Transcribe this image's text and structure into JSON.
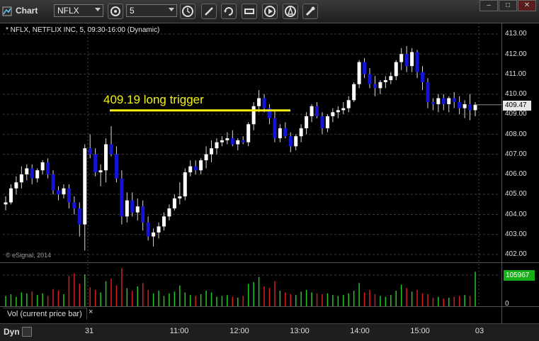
{
  "toolbar": {
    "title": "Chart",
    "symbol": "NFLX",
    "interval": "5",
    "icons": [
      "link-icon",
      "settings-icon",
      "clock-icon",
      "pencil-icon",
      "refresh-icon",
      "news-icon",
      "play-icon",
      "alert-icon",
      "tools-icon"
    ]
  },
  "window_controls": [
    "minimize",
    "maximize",
    "close"
  ],
  "chart": {
    "title": "* NFLX, NETFLIX INC, 5, 09:30-16:00 (Dynamic)",
    "watermark": "© eSignal, 2014",
    "annotation": "409.19 long trigger",
    "annotation_color": "#f4f010",
    "current_price": "409.47",
    "price_ticks": [
      "413.00",
      "412.00",
      "411.00",
      "410.00",
      "409.00",
      "408.00",
      "407.00",
      "406.00",
      "405.00",
      "404.00",
      "403.00",
      "402.00"
    ],
    "colors": {
      "up": "#ffffff",
      "down": "#1414d8",
      "vol_up": "#22c922",
      "vol_down": "#d81e1e"
    }
  },
  "volume": {
    "label": "Vol (current price bar)",
    "last_value": "105967",
    "zero_label": "0",
    "close_glyph": "×"
  },
  "bottom": {
    "mode": "Dyn",
    "time_labels": [
      "31",
      "11:00",
      "12:00",
      "13:00",
      "14:00",
      "15:00",
      "03"
    ]
  },
  "chart_data": {
    "type": "candlestick",
    "ylim": [
      401.8,
      413.5
    ],
    "long_trigger": 409.19,
    "candles": [
      [
        404.5,
        404.9,
        404.2,
        404.6
      ],
      [
        404.6,
        405.5,
        404.5,
        405.3
      ],
      [
        405.3,
        405.9,
        405.0,
        405.6
      ],
      [
        405.6,
        406.4,
        405.3,
        406.0
      ],
      [
        406.0,
        406.5,
        405.7,
        406.3
      ],
      [
        406.3,
        406.5,
        405.5,
        405.8
      ],
      [
        405.8,
        406.3,
        405.6,
        406.2
      ],
      [
        406.2,
        406.7,
        406.0,
        406.6
      ],
      [
        406.6,
        406.8,
        405.8,
        406.0
      ],
      [
        406.0,
        406.2,
        405.0,
        405.2
      ],
      [
        405.2,
        405.4,
        404.7,
        405.0
      ],
      [
        405.0,
        405.5,
        404.8,
        405.3
      ],
      [
        405.3,
        405.5,
        404.3,
        404.6
      ],
      [
        404.6,
        404.9,
        404.0,
        404.3
      ],
      [
        404.3,
        404.6,
        402.9,
        403.5
      ],
      [
        403.5,
        407.5,
        402.2,
        407.3
      ],
      [
        407.3,
        408.0,
        406.8,
        407.0
      ],
      [
        407.0,
        407.3,
        405.9,
        406.1
      ],
      [
        406.1,
        406.5,
        405.4,
        406.2
      ],
      [
        406.2,
        407.8,
        405.6,
        407.5
      ],
      [
        407.5,
        408.4,
        406.9,
        407.0
      ],
      [
        407.0,
        407.4,
        405.6,
        405.8
      ],
      [
        405.8,
        406.2,
        403.5,
        403.9
      ],
      [
        403.9,
        405.1,
        403.6,
        404.7
      ],
      [
        404.7,
        405.1,
        403.9,
        404.1
      ],
      [
        404.1,
        404.8,
        403.7,
        404.4
      ],
      [
        404.4,
        404.7,
        403.2,
        403.6
      ],
      [
        403.6,
        403.9,
        402.7,
        402.9
      ],
      [
        402.9,
        403.3,
        402.4,
        403.1
      ],
      [
        403.1,
        403.6,
        402.8,
        403.4
      ],
      [
        403.4,
        404.1,
        403.2,
        403.9
      ],
      [
        403.9,
        404.5,
        403.7,
        404.3
      ],
      [
        404.3,
        405.0,
        404.2,
        404.8
      ],
      [
        404.8,
        405.6,
        404.5,
        404.9
      ],
      [
        404.9,
        406.3,
        404.7,
        406.1
      ],
      [
        406.1,
        406.7,
        405.9,
        406.4
      ],
      [
        406.4,
        406.7,
        406.0,
        406.2
      ],
      [
        406.2,
        406.8,
        406.0,
        406.7
      ],
      [
        406.7,
        407.4,
        406.3,
        407.0
      ],
      [
        407.0,
        407.7,
        406.6,
        407.3
      ],
      [
        407.3,
        407.8,
        407.0,
        407.6
      ],
      [
        407.6,
        407.9,
        407.4,
        407.7
      ],
      [
        407.7,
        408.1,
        407.5,
        407.8
      ],
      [
        407.8,
        408.2,
        407.4,
        407.5
      ],
      [
        407.5,
        407.8,
        407.2,
        407.7
      ],
      [
        407.7,
        407.9,
        407.5,
        407.6
      ],
      [
        407.6,
        408.6,
        407.4,
        408.5
      ],
      [
        408.5,
        409.6,
        408.2,
        409.4
      ],
      [
        409.4,
        410.2,
        409.1,
        409.8
      ],
      [
        409.8,
        410.0,
        409.1,
        409.3
      ],
      [
        409.3,
        409.5,
        408.5,
        408.8
      ],
      [
        408.8,
        409.2,
        407.6,
        407.8
      ],
      [
        407.8,
        408.5,
        407.6,
        408.3
      ],
      [
        408.3,
        408.6,
        407.8,
        407.9
      ],
      [
        407.9,
        408.1,
        407.1,
        407.4
      ],
      [
        407.4,
        408.0,
        407.2,
        407.9
      ],
      [
        407.9,
        408.5,
        407.6,
        408.3
      ],
      [
        408.3,
        409.1,
        408.0,
        408.9
      ],
      [
        408.9,
        409.5,
        408.6,
        409.4
      ],
      [
        409.4,
        409.6,
        408.8,
        408.9
      ],
      [
        408.9,
        409.1,
        408.0,
        408.3
      ],
      [
        408.3,
        409.0,
        408.1,
        408.9
      ],
      [
        408.9,
        409.3,
        408.6,
        409.1
      ],
      [
        409.1,
        409.4,
        408.8,
        409.2
      ],
      [
        409.2,
        409.6,
        409.0,
        409.3
      ],
      [
        409.3,
        409.9,
        409.1,
        409.7
      ],
      [
        409.7,
        410.6,
        409.6,
        410.5
      ],
      [
        410.5,
        411.7,
        410.3,
        411.6
      ],
      [
        411.6,
        411.8,
        410.8,
        411.0
      ],
      [
        411.0,
        411.3,
        410.3,
        410.5
      ],
      [
        410.5,
        410.9,
        409.9,
        410.3
      ],
      [
        410.3,
        410.7,
        410.0,
        410.6
      ],
      [
        410.6,
        410.9,
        410.3,
        410.7
      ],
      [
        410.7,
        411.1,
        410.5,
        410.9
      ],
      [
        410.9,
        411.7,
        410.7,
        411.6
      ],
      [
        411.6,
        412.3,
        411.2,
        412.0
      ],
      [
        412.0,
        412.4,
        411.1,
        411.4
      ],
      [
        411.4,
        412.3,
        411.1,
        412.1
      ],
      [
        412.1,
        412.2,
        410.8,
        411.1
      ],
      [
        411.1,
        411.4,
        410.2,
        410.6
      ],
      [
        410.6,
        410.8,
        409.3,
        409.6
      ],
      [
        409.6,
        409.8,
        409.2,
        409.5
      ],
      [
        409.5,
        410.0,
        409.1,
        409.8
      ],
      [
        409.8,
        410.0,
        409.2,
        409.5
      ],
      [
        409.5,
        409.9,
        409.1,
        409.8
      ],
      [
        409.8,
        410.1,
        409.3,
        409.6
      ],
      [
        409.6,
        409.9,
        409.0,
        409.3
      ],
      [
        409.3,
        409.7,
        408.8,
        409.5
      ],
      [
        409.5,
        410.0,
        408.7,
        409.2
      ],
      [
        409.2,
        409.6,
        408.9,
        409.47
      ]
    ],
    "volume": [
      1.2,
      1.4,
      1.1,
      1.6,
      1.5,
      1.7,
      1.3,
      1.5,
      1.2,
      2.0,
      1.8,
      1.4,
      3.5,
      3.8,
      2.6,
      3.7,
      2.2,
      1.9,
      1.6,
      2.9,
      3.2,
      2.4,
      4.4,
      2.1,
      1.8,
      2.3,
      2.7,
      1.9,
      1.5,
      1.8,
      1.2,
      1.5,
      1.7,
      2.4,
      1.6,
      1.3,
      1.2,
      1.4,
      1.8,
      1.6,
      1.1,
      1.2,
      1.3,
      1.1,
      1.0,
      1.2,
      2.6,
      2.8,
      3.4,
      2.3,
      2.1,
      2.9,
      1.8,
      1.6,
      1.4,
      1.3,
      1.7,
      1.9,
      1.6,
      1.5,
      1.4,
      1.5,
      1.3,
      1.2,
      1.3,
      1.5,
      1.8,
      2.7,
      1.6,
      1.9,
      1.4,
      1.2,
      1.1,
      1.3,
      1.8,
      2.5,
      2.1,
      1.7,
      1.9,
      1.5,
      1.4,
      1.0,
      1.1,
      0.9,
      1.0,
      1.1,
      1.2,
      1.3,
      1.2,
      4.0
    ]
  }
}
